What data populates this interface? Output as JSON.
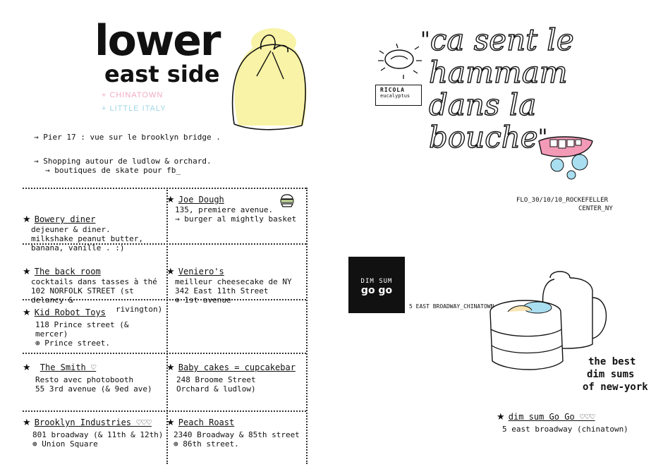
{
  "left_page": {
    "title_big": "lower",
    "title_small": "east side",
    "subtitles": [
      "+ CHINATOWN",
      "+ LITTLE ITALY"
    ],
    "colors": {
      "chinatown": "#f2a9c4",
      "little_italy": "#9fd6e6",
      "hat_fill": "#f8f3a6"
    },
    "notes": [
      {
        "text": "Pier 17 : vue sur le brooklyn bridge ."
      },
      {
        "text": "Shopping autour de ludlow & orchard.",
        "sub": "→ boutiques de skate pour fb_"
      }
    ],
    "entries": [
      {
        "name": "Bowery diner",
        "lines": [
          "dejeuner & diner.",
          "milkshake peanut butter,",
          "banana, vanille . :)"
        ],
        "star": true
      },
      {
        "name": "Joe Dough",
        "lines": [
          "135, premiere avenue.",
          "→ burger al mightly basket"
        ],
        "star": true
      },
      {
        "name": "The back room",
        "lines": [
          "cocktails dans tasses à thé",
          "102 NORFOLK STREET (st delancy &",
          "rivington)"
        ],
        "star": true
      },
      {
        "name": "Veniero's",
        "lines": [
          "meilleur cheesecake de NY",
          "342 East 11th Street",
          "⊕ 1st avenue"
        ],
        "star": true
      },
      {
        "name": "Kid Robot Toys",
        "lines": [
          "118 Prince street (& mercer)",
          "⊕ Prince street."
        ],
        "star": true
      },
      {
        "name": "",
        "lines": [],
        "star": false
      },
      {
        "name": "The Smith ♡",
        "lines": [
          "Resto avec photobooth",
          "55 3rd avenue (& 9ed ave)"
        ],
        "star": true
      },
      {
        "name": "Baby cakes = cupcakebar",
        "lines": [
          "248 Broome Street",
          "Orchard & ludlow)"
        ],
        "star": true
      },
      {
        "name": "Brooklyn Industries ♡♡♡",
        "lines": [
          "801 broadway (& 11th & 12th)",
          "⊕ Union Square"
        ],
        "star": true
      },
      {
        "name": "Peach Roast",
        "lines": [
          "2340 Broadway & 85th street",
          "⊕ 86th street."
        ],
        "star": true
      }
    ]
  },
  "right_page": {
    "quote_open": "\"",
    "quote_lines": [
      "ca sent le",
      "hammam",
      "dans la",
      "bouche"
    ],
    "quote_close": "\"",
    "candy_label": [
      "RICOLA",
      "eucalyptus"
    ],
    "signature": [
      "FLO_30/10/10_ROCKEFELLER",
      "CENTER_NY"
    ],
    "dimsum_logo": [
      "DIM SUM",
      "go go"
    ],
    "dimsum_address": "5 EAST BROADWAY_CHINATOWN",
    "best_lines": [
      "the best",
      "dim sums",
      "of new-york"
    ],
    "bottom_entry": {
      "name": "dim sum Go Go ♡♡♡",
      "address": "5 east broadway (chinatown)"
    }
  }
}
